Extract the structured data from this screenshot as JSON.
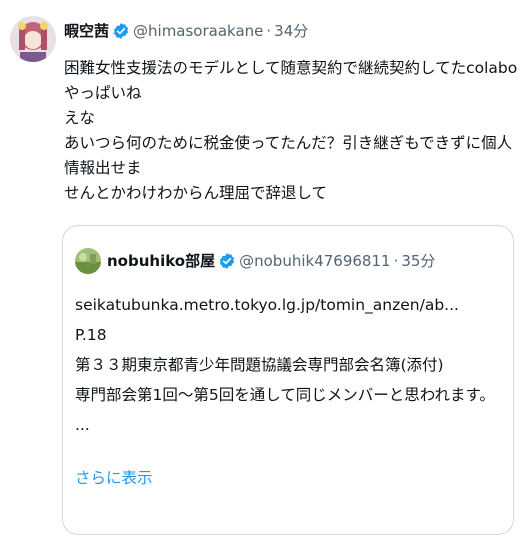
{
  "tweet": {
    "author_name": "暇空茜",
    "handle": "@himasoraakane",
    "separator": "·",
    "time": "34分",
    "text_lines": [
      "困難女性支援法のモデルとして随意契約で継続契約してたcolaboやっぱいね",
      "えな",
      "あいつら何のために税金使ってたんだ？引き継ぎもできずに個人情報出せま",
      "せんとかわけわからん理屈で辞退して"
    ]
  },
  "quote": {
    "author_name": "nobuhiko部屋",
    "handle": "@nobuhik47696811",
    "separator": "·",
    "time": "35分",
    "lines": [
      "seikatubunka.metro.tokyo.lg.jp/tomin_anzen/ab...",
      "P.18",
      "第３３期東京都青少年問題協議会専門部会名簿(添付)",
      "専門部会第1回～第5回を通して同じメンバーと思われます。",
      "..."
    ],
    "show_more": "さらに表示"
  },
  "colors": {
    "accent": "#1d9bf0",
    "secondary_text": "#536471",
    "border": "#cfd9de"
  },
  "icons": [
    "avatar",
    "verified-badge-icon",
    "more-options-icon"
  ]
}
